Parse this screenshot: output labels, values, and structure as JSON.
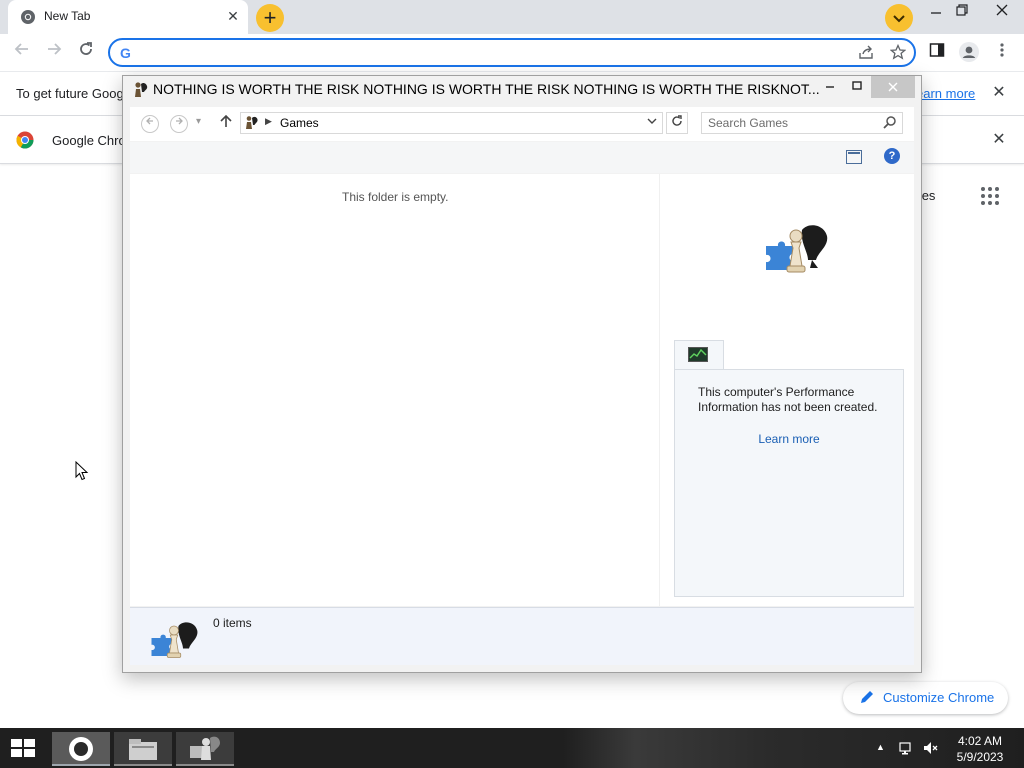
{
  "browser": {
    "tab_title": "New Tab",
    "tab_close_glyph": "✕",
    "new_tab_glyph": "+",
    "omnibox_value": "",
    "infobar_text": "To get future Goog",
    "infobar_link": "earn more",
    "promo_text": "Google Chro",
    "close_glyph": "✕",
    "ntp_images": "nages",
    "customize_label": "Customize Chrome",
    "accent_color": "#1a73e8",
    "tab_button_color": "#f8c02f"
  },
  "explorer": {
    "title": "NOTHING IS WORTH THE RISK NOTHING IS WORTH THE RISK NOTHING IS WORTH THE RISKNOT...",
    "address": "Games",
    "search_placeholder": "Search Games",
    "empty_text": "This folder is empty.",
    "perf_text": "This computer's Performance Information has not been created.",
    "learn_more": "Learn more",
    "items_count": "0 items",
    "help_glyph": "?"
  },
  "taskbar": {
    "time": "4:02 AM",
    "date": "5/9/2023"
  }
}
